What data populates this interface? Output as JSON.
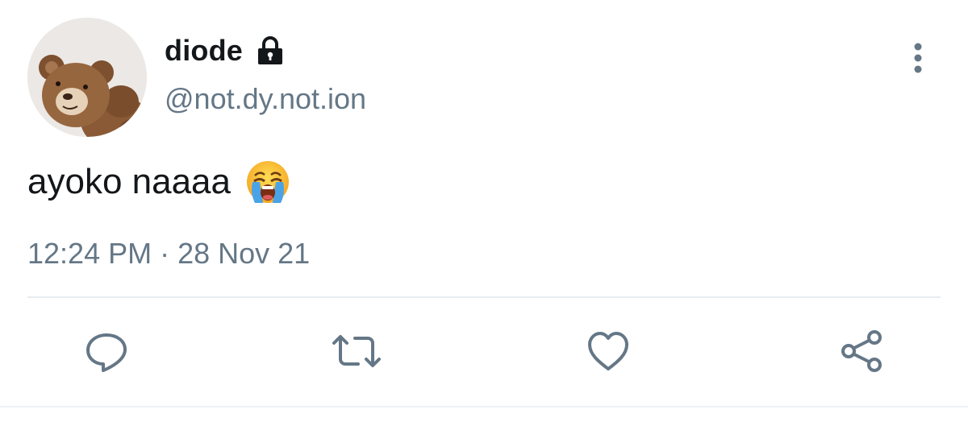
{
  "tweet": {
    "display_name": "diode",
    "handle": "@not.dy.not.ion",
    "text": "ayoko naaaa",
    "time": "12:24 PM",
    "separator": "·",
    "date": "28 Nov 21",
    "icons": {
      "avatar": "teddy-bear-avatar",
      "lock": "lock-icon",
      "emoji": "loudly-crying-face-emoji",
      "more": "more-vertical-icon"
    }
  },
  "actions": [
    {
      "name": "reply",
      "icon": "reply-icon"
    },
    {
      "name": "retweet",
      "icon": "retweet-icon"
    },
    {
      "name": "like",
      "icon": "heart-icon"
    },
    {
      "name": "share",
      "icon": "share-icon"
    }
  ],
  "colors": {
    "text_primary": "#14171a",
    "text_secondary": "#657786",
    "icon": "#657786",
    "divider": "#e6ecf0",
    "background": "#ffffff"
  }
}
